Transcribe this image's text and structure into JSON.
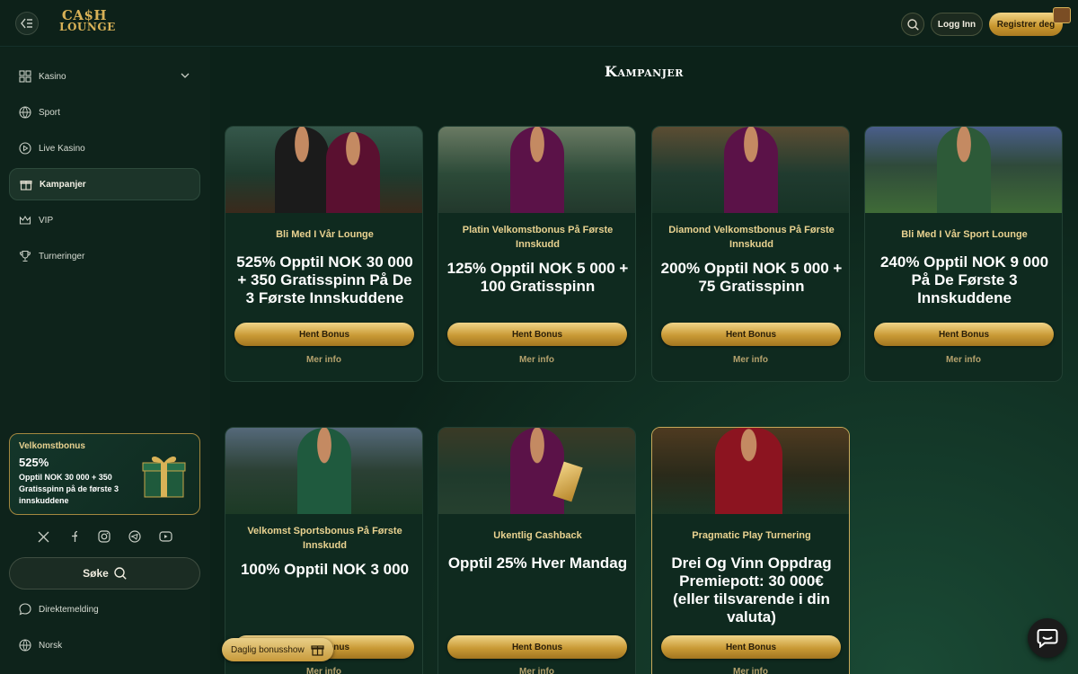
{
  "header": {
    "logo_top": "CA$H",
    "logo_bottom": "LOUNGE",
    "login_label": "Logg Inn",
    "register_label": "Registrer deg"
  },
  "sidebar": {
    "items": [
      {
        "label": "Kasino",
        "icon": "grid-icon"
      },
      {
        "label": "Sport",
        "icon": "ball-icon"
      },
      {
        "label": "Live Kasino",
        "icon": "play-icon"
      },
      {
        "label": "Kampanjer",
        "icon": "gift-icon",
        "active": true
      },
      {
        "label": "VIP",
        "icon": "crown-icon"
      },
      {
        "label": "Turneringer",
        "icon": "trophy-icon"
      }
    ],
    "promo": {
      "title": "Velkomstbonus",
      "amount": "525%",
      "desc": "Opptil NOK 30 000 + 350 Gratisspinn på de første 3 innskuddene"
    },
    "search_label": "Søke",
    "bottom_items": [
      {
        "label": "Direktemelding",
        "icon": "chat-icon"
      },
      {
        "label": "Norsk",
        "icon": "globe-icon"
      }
    ]
  },
  "main": {
    "title": "Kampanjer",
    "cards": [
      {
        "title": "Bli Med I Vår Lounge",
        "offer": "525% Opptil NOK 30 000 + 350 Gratisspinn På De 3 Første Innskuddene",
        "button": "Hent Bonus",
        "more": "Mer info"
      },
      {
        "title": "Platin Velkomstbonus På Første Innskudd",
        "offer": "125% Opptil NOK 5 000 + 100 Gratisspinn",
        "button": "Hent Bonus",
        "more": "Mer info"
      },
      {
        "title": "Diamond Velkomstbonus På Første Innskudd",
        "offer": "200% Opptil NOK 5 000 + 75 Gratisspinn",
        "button": "Hent Bonus",
        "more": "Mer info"
      },
      {
        "title": "Bli Med I Vår Sport Lounge",
        "offer": "240% Opptil NOK 9 000 På De Første 3 Innskuddene",
        "button": "Hent Bonus",
        "more": "Mer info"
      },
      {
        "title": "Velkomst Sportsbonus På Første Innskudd",
        "offer": "100% Opptil NOK 3 000",
        "button": "Hent Bonus",
        "more": "Mer info"
      },
      {
        "title": "Ukentlig Cashback",
        "offer": "Opptil 25% Hver Mandag",
        "button": "Hent Bonus",
        "more": "Mer info"
      },
      {
        "title": "Pragmatic Play Turnering",
        "offer": "Drei Og Vinn Oppdrag Premiepott: 30 000€ (eller tilsvarende i din valuta)",
        "button": "Hent Bonus",
        "more": "Mer info"
      }
    ],
    "daily_bonus": "Daglig bonusshow"
  },
  "colors": {
    "gold": "#d9b257",
    "background": "#0c2219",
    "card": "#0f2a1f",
    "title_gold": "#e9d290"
  }
}
